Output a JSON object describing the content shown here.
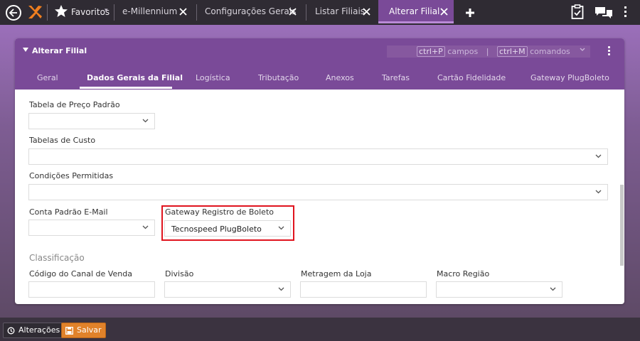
{
  "topbar": {
    "favorites_label": "Favoritos",
    "favorites_caret": "▾",
    "tabs": [
      {
        "label": "e-Millennium"
      },
      {
        "label": "Configurações Gerais"
      },
      {
        "label": "Listar Filiais"
      },
      {
        "label": "Alterar Filial"
      }
    ]
  },
  "panel": {
    "title": "Alterar Filial",
    "hint_fields_key": "ctrl+P",
    "hint_fields_label": "campos",
    "hint_separator": "|",
    "hint_commands_key": "ctrl+M",
    "hint_commands_label": "comandos",
    "tabs": [
      {
        "label": "Geral"
      },
      {
        "label": "Dados Gerais da Filial"
      },
      {
        "label": "Logística"
      },
      {
        "label": "Tributação"
      },
      {
        "label": "Anexos"
      },
      {
        "label": "Tarefas"
      },
      {
        "label": "Cartão Fidelidade"
      },
      {
        "label": "Gateway PlugBoleto"
      }
    ],
    "active_tab": "Dados Gerais da Filial"
  },
  "form": {
    "tabela_preco_label": "Tabela de Preço Padrão",
    "tabela_preco_value": "",
    "tabelas_custo_label": "Tabelas de Custo",
    "tabelas_custo_value": "",
    "condicoes_label": "Condições Permitidas",
    "condicoes_value": "",
    "conta_email_label": "Conta Padrão E-Mail",
    "conta_email_value": "",
    "gateway_label": "Gateway Registro de Boleto",
    "gateway_value": "Tecnospeed PlugBoleto",
    "section_classificacao": "Classificação",
    "canal_venda_label": "Código do Canal de Venda",
    "canal_venda_value": "",
    "divisao_label": "Divisão",
    "divisao_value": "",
    "metragem_label": "Metragem da Loja",
    "metragem_value": "",
    "macro_regiao_label": "Macro Região",
    "macro_regiao_value": ""
  },
  "bottombar": {
    "alteracoes_label": "Alterações",
    "salvar_label": "Salvar"
  },
  "colors": {
    "accent_purple": "#7a4a98",
    "highlight_red": "#e0141e",
    "save_orange": "#e1822a"
  }
}
